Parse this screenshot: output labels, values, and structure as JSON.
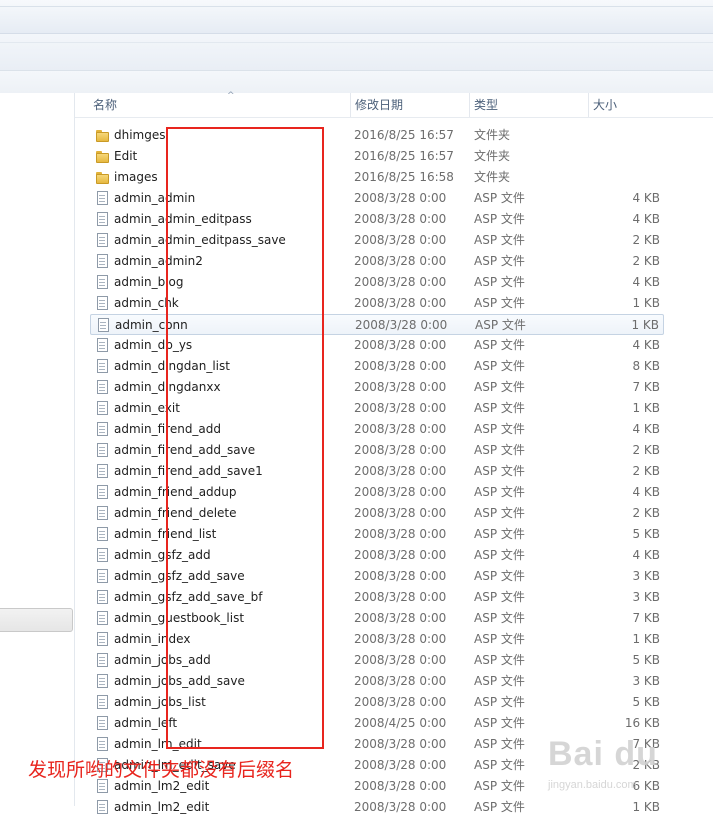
{
  "columns": {
    "name": "名称",
    "date": "修改日期",
    "type": "类型",
    "size": "大小"
  },
  "files": [
    {
      "name": "dhimges",
      "date": "2016/8/25 16:57",
      "type": "文件夹",
      "size": "",
      "kind": "folder"
    },
    {
      "name": "Edit",
      "date": "2016/8/25 16:57",
      "type": "文件夹",
      "size": "",
      "kind": "folder"
    },
    {
      "name": "images",
      "date": "2016/8/25 16:58",
      "type": "文件夹",
      "size": "",
      "kind": "folder"
    },
    {
      "name": "admin_admin",
      "date": "2008/3/28 0:00",
      "type": "ASP 文件",
      "size": "4 KB",
      "kind": "file"
    },
    {
      "name": "admin_admin_editpass",
      "date": "2008/3/28 0:00",
      "type": "ASP 文件",
      "size": "4 KB",
      "kind": "file"
    },
    {
      "name": "admin_admin_editpass_save",
      "date": "2008/3/28 0:00",
      "type": "ASP 文件",
      "size": "2 KB",
      "kind": "file"
    },
    {
      "name": "admin_admin2",
      "date": "2008/3/28 0:00",
      "type": "ASP 文件",
      "size": "2 KB",
      "kind": "file"
    },
    {
      "name": "admin_blog",
      "date": "2008/3/28 0:00",
      "type": "ASP 文件",
      "size": "4 KB",
      "kind": "file"
    },
    {
      "name": "admin_chk",
      "date": "2008/3/28 0:00",
      "type": "ASP 文件",
      "size": "1 KB",
      "kind": "file"
    },
    {
      "name": "admin_conn",
      "date": "2008/3/28 0:00",
      "type": "ASP 文件",
      "size": "1 KB",
      "kind": "file",
      "selected": true
    },
    {
      "name": "admin_db_ys",
      "date": "2008/3/28 0:00",
      "type": "ASP 文件",
      "size": "4 KB",
      "kind": "file"
    },
    {
      "name": "admin_dingdan_list",
      "date": "2008/3/28 0:00",
      "type": "ASP 文件",
      "size": "8 KB",
      "kind": "file"
    },
    {
      "name": "admin_dingdanxx",
      "date": "2008/3/28 0:00",
      "type": "ASP 文件",
      "size": "7 KB",
      "kind": "file"
    },
    {
      "name": "admin_exit",
      "date": "2008/3/28 0:00",
      "type": "ASP 文件",
      "size": "1 KB",
      "kind": "file"
    },
    {
      "name": "admin_firend_add",
      "date": "2008/3/28 0:00",
      "type": "ASP 文件",
      "size": "4 KB",
      "kind": "file"
    },
    {
      "name": "admin_firend_add_save",
      "date": "2008/3/28 0:00",
      "type": "ASP 文件",
      "size": "2 KB",
      "kind": "file"
    },
    {
      "name": "admin_firend_add_save1",
      "date": "2008/3/28 0:00",
      "type": "ASP 文件",
      "size": "2 KB",
      "kind": "file"
    },
    {
      "name": "admin_friend_addup",
      "date": "2008/3/28 0:00",
      "type": "ASP 文件",
      "size": "4 KB",
      "kind": "file"
    },
    {
      "name": "admin_friend_delete",
      "date": "2008/3/28 0:00",
      "type": "ASP 文件",
      "size": "2 KB",
      "kind": "file"
    },
    {
      "name": "admin_friend_list",
      "date": "2008/3/28 0:00",
      "type": "ASP 文件",
      "size": "5 KB",
      "kind": "file"
    },
    {
      "name": "admin_gsfz_add",
      "date": "2008/3/28 0:00",
      "type": "ASP 文件",
      "size": "4 KB",
      "kind": "file"
    },
    {
      "name": "admin_gsfz_add_save",
      "date": "2008/3/28 0:00",
      "type": "ASP 文件",
      "size": "3 KB",
      "kind": "file"
    },
    {
      "name": "admin_gsfz_add_save_bf",
      "date": "2008/3/28 0:00",
      "type": "ASP 文件",
      "size": "3 KB",
      "kind": "file"
    },
    {
      "name": "admin_guestbook_list",
      "date": "2008/3/28 0:00",
      "type": "ASP 文件",
      "size": "7 KB",
      "kind": "file"
    },
    {
      "name": "admin_index",
      "date": "2008/3/28 0:00",
      "type": "ASP 文件",
      "size": "1 KB",
      "kind": "file"
    },
    {
      "name": "admin_jobs_add",
      "date": "2008/3/28 0:00",
      "type": "ASP 文件",
      "size": "5 KB",
      "kind": "file"
    },
    {
      "name": "admin_jobs_add_save",
      "date": "2008/3/28 0:00",
      "type": "ASP 文件",
      "size": "3 KB",
      "kind": "file"
    },
    {
      "name": "admin_jobs_list",
      "date": "2008/3/28 0:00",
      "type": "ASP 文件",
      "size": "5 KB",
      "kind": "file"
    },
    {
      "name": "admin_left",
      "date": "2008/4/25 0:00",
      "type": "ASP 文件",
      "size": "16 KB",
      "kind": "file"
    },
    {
      "name": "admin_lm_edit",
      "date": "2008/3/28 0:00",
      "type": "ASP 文件",
      "size": "7 KB",
      "kind": "file"
    },
    {
      "name": "admin_lm_edit_save",
      "date": "2008/3/28 0:00",
      "type": "ASP 文件",
      "size": "2 KB",
      "kind": "file"
    },
    {
      "name": "admin_lm2_edit",
      "date": "2008/3/28 0:00",
      "type": "ASP 文件",
      "size": "6 KB",
      "kind": "file"
    },
    {
      "name": "admin_lm2_edit",
      "date": "2008/3/28 0:00",
      "type": "ASP 文件",
      "size": "1 KB",
      "kind": "file"
    }
  ],
  "annotation": "发现所哟的文件夹都没有后缀名",
  "watermark": {
    "big": "Bai du",
    "small": "jingyan.baidu.com"
  },
  "colors": {
    "annotation": "#e8251e",
    "folder": "#f0c850",
    "selection": "#e8f0f8"
  }
}
